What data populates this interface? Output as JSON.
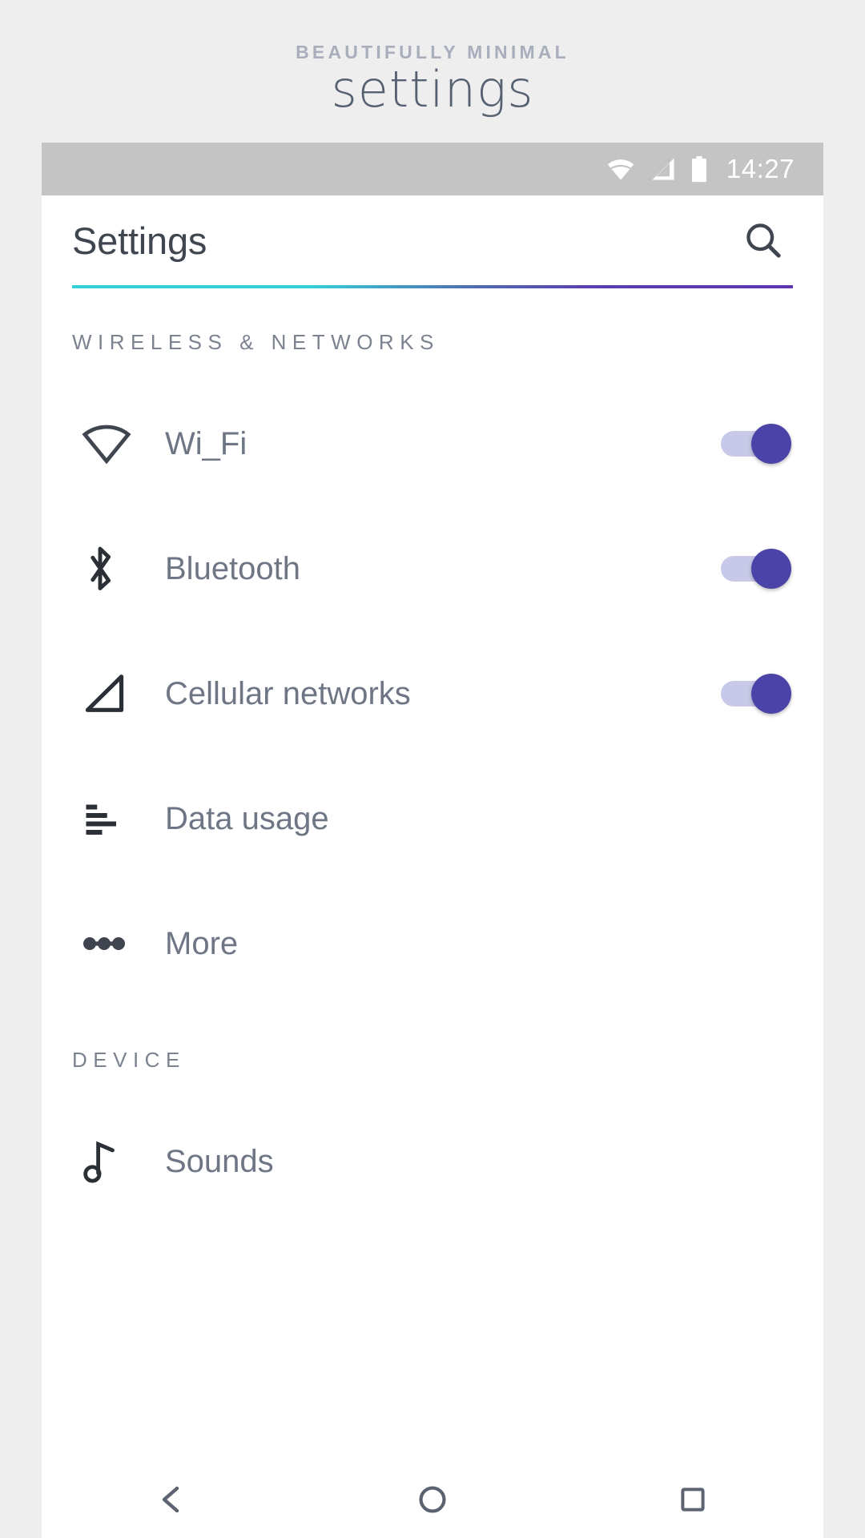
{
  "promo": {
    "kicker": "BEAUTIFULLY MINIMAL",
    "title": "settings"
  },
  "statusbar": {
    "time": "14:27",
    "icons": [
      "wifi-icon",
      "cellular-signal-icon",
      "battery-icon"
    ]
  },
  "appbar": {
    "title": "Settings",
    "search_icon": "search-icon"
  },
  "gradient": {
    "start": "#35cfd8",
    "mid": "#4f6fb0",
    "end": "#5e35b1"
  },
  "colors": {
    "toggle_track": "#c8c9e8",
    "toggle_knob": "#4c43a8",
    "label": "#6e7685",
    "section_header": "#7b8290",
    "statusbar_bg": "#c4c4c4"
  },
  "sections": [
    {
      "header": "WIRELESS & NETWORKS",
      "rows": [
        {
          "label": "Wi_Fi",
          "icon": "wifi-icon",
          "toggle": true,
          "toggle_on": true
        },
        {
          "label": "Bluetooth",
          "icon": "bluetooth-icon",
          "toggle": true,
          "toggle_on": true
        },
        {
          "label": "Cellular networks",
          "icon": "cellular-signal-icon",
          "toggle": true,
          "toggle_on": true
        },
        {
          "label": "Data usage",
          "icon": "data-usage-icon",
          "toggle": false
        },
        {
          "label": "More",
          "icon": "more-dots-icon",
          "toggle": false
        }
      ]
    },
    {
      "header": "DEVICE",
      "rows": [
        {
          "label": "Sounds",
          "icon": "music-note-icon",
          "toggle": false
        }
      ]
    }
  ],
  "navbar": {
    "back": "back-icon",
    "home": "home-icon",
    "recents": "recents-icon"
  }
}
